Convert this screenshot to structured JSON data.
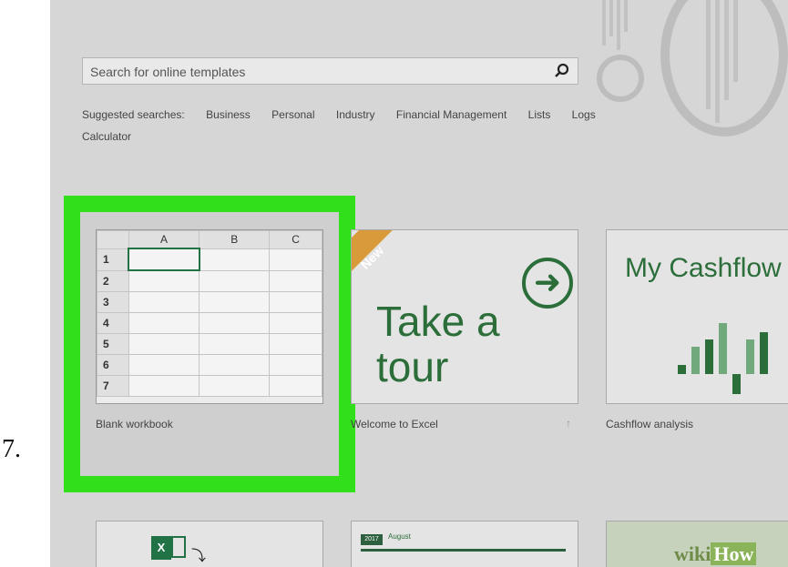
{
  "step_number": "7.",
  "search": {
    "placeholder": "Search for online templates"
  },
  "suggested": {
    "label": "Suggested searches:",
    "items": [
      "Business",
      "Personal",
      "Industry",
      "Financial Management",
      "Lists",
      "Logs",
      "Calculator"
    ]
  },
  "templates": [
    {
      "label": "Blank workbook",
      "columns": [
        "A",
        "B",
        "C"
      ],
      "rows": [
        "1",
        "2",
        "3",
        "4",
        "5",
        "6",
        "7"
      ]
    },
    {
      "label": "Welcome to Excel",
      "badge": "New",
      "title_line1": "Take a",
      "title_line2": "tour"
    },
    {
      "label": "Cashflow analysis",
      "title": "My Cashflow"
    }
  ],
  "bottom_row": {
    "calendar_year": "2017",
    "calendar_month": "August"
  },
  "watermark": {
    "wiki": "wiki",
    "how": "How"
  },
  "colors": {
    "highlight": "#31e01b",
    "excel_green": "#2b6e3a",
    "badge": "#d99a3a"
  }
}
